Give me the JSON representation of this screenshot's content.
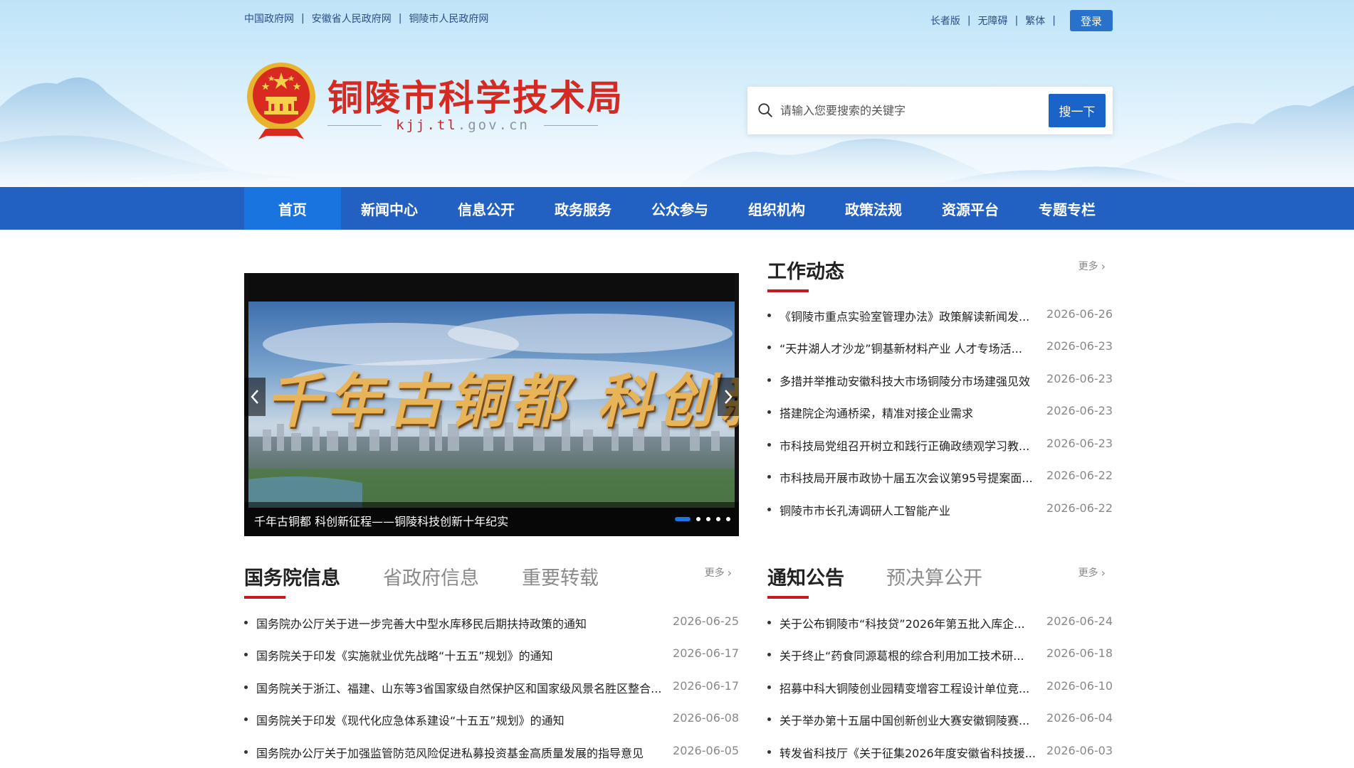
{
  "topbar": {
    "left_links": [
      "中国政府网",
      "安徽省人民政府网",
      "铜陵市人民政府网"
    ],
    "right_links": [
      "长者版",
      "无障碍",
      "繁体"
    ],
    "login": "登录"
  },
  "brand": {
    "title": "铜陵市科学技术局",
    "domain_highlight": "kjj.tl",
    "domain_rest": ".gov.cn",
    "title_color": "#d42a22"
  },
  "search": {
    "placeholder": "请输入您要搜索的关键字",
    "button": "搜一下",
    "icon": "search-icon"
  },
  "nav": {
    "items": [
      "首页",
      "新闻中心",
      "信息公开",
      "政务服务",
      "公众参与",
      "组织机构",
      "政策法规",
      "资源平台",
      "专题专栏"
    ],
    "active_index": 0,
    "bg_color": "#2260c2"
  },
  "carousel": {
    "slide_text": "千年古铜都  科创新征程",
    "caption": "千年古铜都 科创新征程——铜陵科技创新十年纪实",
    "dot_count": 5,
    "active_dot": 0
  },
  "work_news": {
    "title": "工作动态",
    "more": "更多",
    "items": [
      {
        "title": "《铜陵市重点实验室管理办法》政策解读新闻发...",
        "date": "2026-06-26"
      },
      {
        "title": "“天井湖人才沙龙”铜基新材料产业 人才专场活...",
        "date": "2026-06-23"
      },
      {
        "title": "多措并举推动安徽科技大市场铜陵分市场建强见效",
        "date": "2026-06-23"
      },
      {
        "title": "搭建院企沟通桥梁，精准对接企业需求",
        "date": "2026-06-23"
      },
      {
        "title": "市科技局党组召开树立和践行正确政绩观学习教...",
        "date": "2026-06-23"
      },
      {
        "title": "市科技局开展市政协十届五次会议第95号提案面...",
        "date": "2026-06-22"
      },
      {
        "title": "铜陵市市长孔涛调研人工智能产业",
        "date": "2026-06-22"
      }
    ]
  },
  "state_info": {
    "tabs": [
      "国务院信息",
      "省政府信息",
      "重要转载"
    ],
    "active_tab": 0,
    "more": "更多",
    "items": [
      {
        "title": "国务院办公厅关于进一步完善大中型水库移民后期扶持政策的通知",
        "date": "2026-06-25"
      },
      {
        "title": "国务院关于印发《实施就业优先战略“十五五”规划》的通知",
        "date": "2026-06-17"
      },
      {
        "title": "国务院关于浙江、福建、山东等3省国家级自然保护区和国家级风景名胜区整合...",
        "date": "2026-06-17"
      },
      {
        "title": "国务院关于印发《现代化应急体系建设“十五五”规划》的通知",
        "date": "2026-06-08"
      },
      {
        "title": "国务院办公厅关于加强监管防范风险促进私募投资基金高质量发展的指导意见",
        "date": "2026-06-05"
      }
    ]
  },
  "notices": {
    "tabs": [
      "通知公告",
      "预决算公开"
    ],
    "active_tab": 0,
    "more": "更多",
    "items": [
      {
        "title": "关于公布铜陵市“科技贷”2026年第五批入库企...",
        "date": "2026-06-24"
      },
      {
        "title": "关于终止“药食同源葛根的综合利用加工技术研...",
        "date": "2026-06-18"
      },
      {
        "title": "招募中科大铜陵创业园精变增容工程设计单位竞...",
        "date": "2026-06-10"
      },
      {
        "title": "关于举办第十五届中国创新创业大赛安徽铜陵赛...",
        "date": "2026-06-04"
      },
      {
        "title": "转发省科技厅《关于征集2026年度安徽省科技援...",
        "date": "2026-06-03"
      }
    ]
  },
  "colors": {
    "accent_red": "#c8181f",
    "primary_blue": "#1a63c9"
  }
}
